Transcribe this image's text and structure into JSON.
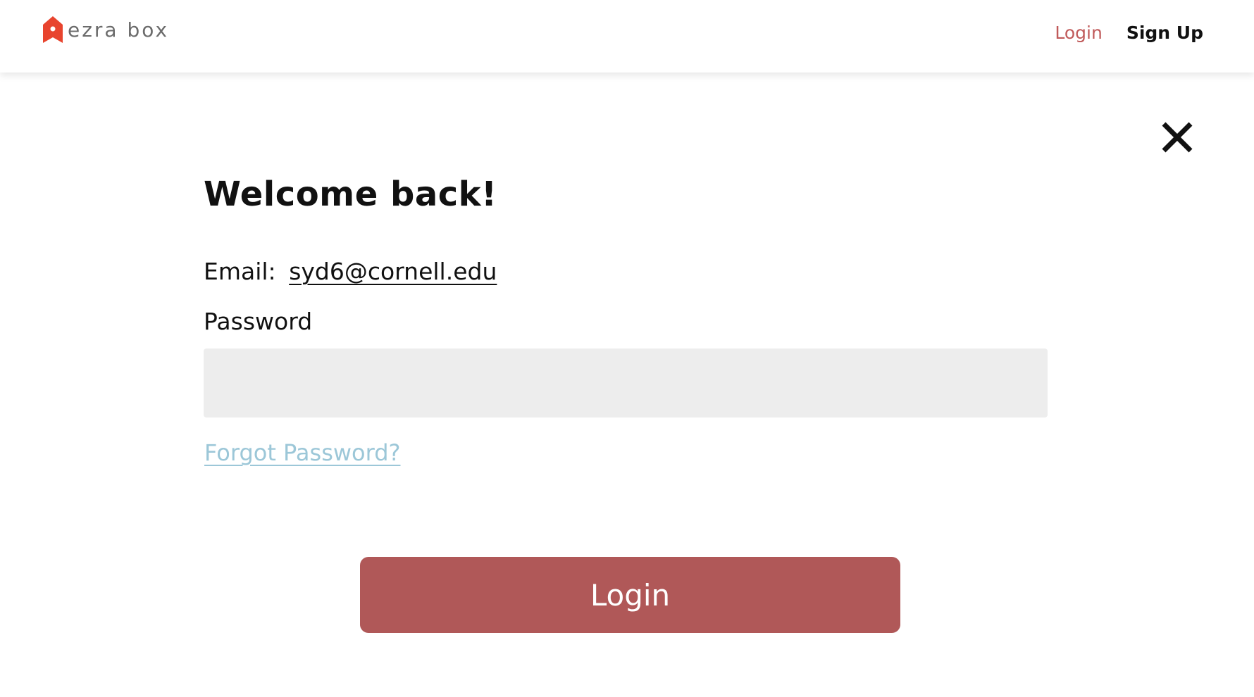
{
  "brand": {
    "name": "ezra box",
    "logo_icon": "house-pin-icon",
    "logo_color": "#e8442e"
  },
  "nav": {
    "login_label": "Login",
    "signup_label": "Sign Up",
    "login_color": "#c05a5a"
  },
  "modal": {
    "close_icon": "close-icon",
    "title": "Welcome back!",
    "email_label": "Email:",
    "email_value": "syd6@cornell.edu",
    "password_label": "Password",
    "password_value": "",
    "forgot_label": "Forgot Password?",
    "submit_label": "Login",
    "submit_color": "#b05858",
    "forgot_color": "#9cc7d8"
  }
}
